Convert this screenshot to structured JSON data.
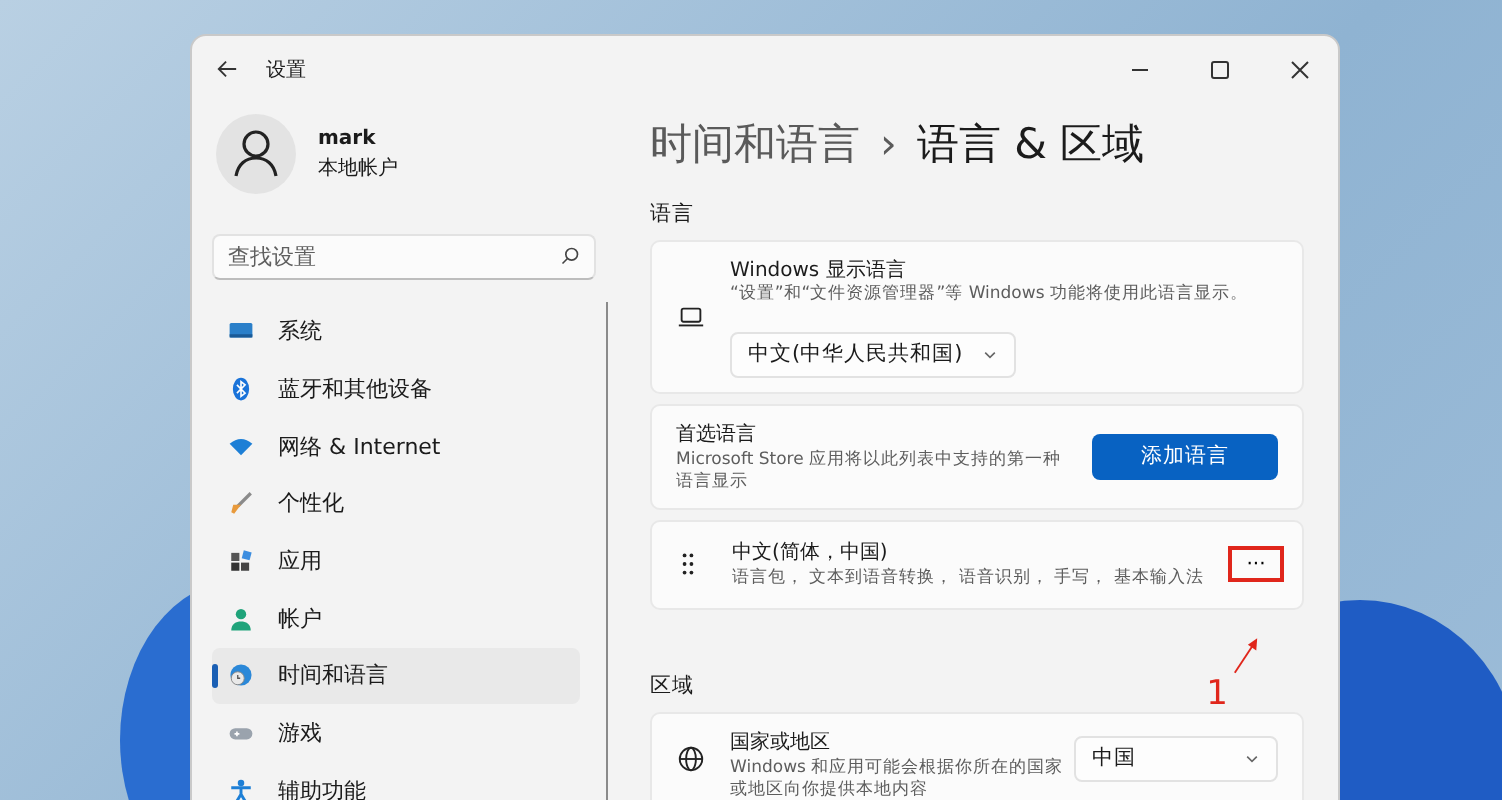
{
  "window": {
    "title": "设置"
  },
  "account": {
    "name": "mark",
    "type": "本地帐户"
  },
  "search": {
    "placeholder": "查找设置"
  },
  "sidebar": {
    "items": [
      {
        "label": "系统",
        "selected": false
      },
      {
        "label": "蓝牙和其他设备",
        "selected": false
      },
      {
        "label": "网络 & Internet",
        "selected": false
      },
      {
        "label": "个性化",
        "selected": false
      },
      {
        "label": "应用",
        "selected": false
      },
      {
        "label": "帐户",
        "selected": false
      },
      {
        "label": "时间和语言",
        "selected": true
      },
      {
        "label": "游戏",
        "selected": false
      },
      {
        "label": "辅助功能",
        "selected": false
      }
    ]
  },
  "breadcrumb": {
    "parent": "时间和语言",
    "separator": "›",
    "current": "语言 & 区域"
  },
  "language_section": {
    "heading": "语言",
    "display_language": {
      "title": "Windows 显示语言",
      "description": "“设置”和“文件资源管理器”等 Windows 功能将使用此语言显示。",
      "value": "中文(中华人民共和国)"
    },
    "preferred": {
      "title": "首选语言",
      "description": "Microsoft Store 应用将以此列表中支持的第一种语言显示",
      "button": "添加语言"
    },
    "languages": [
      {
        "name": "中文(简体，中国)",
        "features": "语言包， 文本到语音转换， 语音识别， 手写， 基本输入法",
        "more": "···",
        "highlighted": true
      }
    ]
  },
  "region_section": {
    "heading": "区域",
    "country": {
      "title": "国家或地区",
      "description": "Windows 和应用可能会根据你所在的国家或地区向你提供本地内容",
      "value": "中国"
    }
  },
  "annotation": {
    "label": "1"
  }
}
